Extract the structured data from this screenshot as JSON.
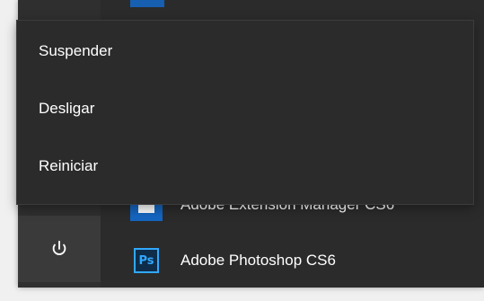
{
  "power_menu": {
    "items": [
      {
        "label": "Suspender"
      },
      {
        "label": "Desligar"
      },
      {
        "label": "Reiniciar"
      }
    ]
  },
  "app_list": {
    "items": [
      {
        "label": "Adobe Extension Manager CS6",
        "icon": "adobe-extension-manager-icon"
      },
      {
        "label": "Adobe Photoshop CS6",
        "icon": "photoshop-icon",
        "icon_text": "Ps"
      }
    ]
  },
  "icons": {
    "power": "power-icon"
  },
  "colors": {
    "menu_bg": "#2b2b2b",
    "rail_bg": "#2f2f2f",
    "power_tile_bg": "#3a3a3a",
    "accent": "#31a8ff",
    "tile_blue": "#1565c0"
  }
}
